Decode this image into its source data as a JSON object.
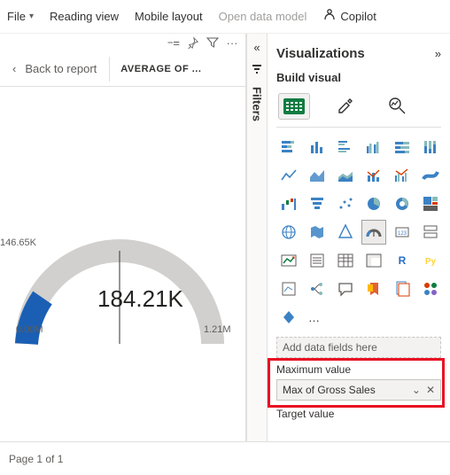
{
  "menubar": {
    "file": "File",
    "reading_view": "Reading view",
    "mobile_layout": "Mobile layout",
    "open_data_model": "Open data model",
    "copilot": "Copilot"
  },
  "report": {
    "back_label": "Back to report",
    "visual_title": "AVERAGE OF ..."
  },
  "gauge": {
    "value_display": "184.21K",
    "min_label": "0.00M",
    "max_label": "1.21M",
    "side_label": "146.65K"
  },
  "filters": {
    "label": "Filters"
  },
  "vis_pane": {
    "title": "Visualizations",
    "build_label": "Build visual",
    "add_placeholder": "Add data fields here",
    "max_section": "Maximum value",
    "max_field": "Max of Gross Sales",
    "target_section": "Target value",
    "more": "…"
  },
  "footer": {
    "page_label": "Page 1 of 1"
  },
  "chart_data": {
    "type": "gauge",
    "value": 184210,
    "min": 0,
    "max": 1210000,
    "fill_color": "#1a5fb4",
    "track_color": "#d2d0ce",
    "value_label": "184.21K",
    "min_label": "0.00M",
    "max_label": "1.21M",
    "annotation": "146.65K"
  }
}
